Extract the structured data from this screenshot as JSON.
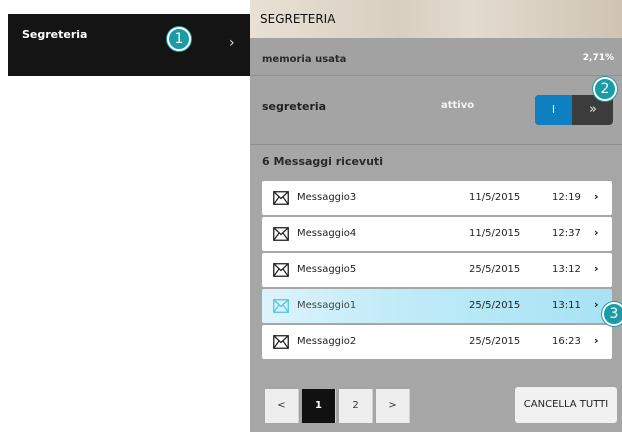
{
  "sidebar": {
    "item_label": "Segreteria",
    "item_chevron": "›"
  },
  "callouts": [
    "1",
    "2",
    "3"
  ],
  "panel": {
    "title": "SEGRETERIA",
    "memory": {
      "label": "memoria usata",
      "value": "2,71%"
    },
    "voicemail": {
      "label": "segreteria",
      "status": "attivo",
      "toggle_on_label": "I",
      "toggle_arrow": "»",
      "enabled": true
    },
    "messages_title": "6 Messaggi ricevuti",
    "messages": [
      {
        "name": "Messaggio3",
        "date": "11/5/2015",
        "time": "12:19",
        "selected": false
      },
      {
        "name": "Messaggio4",
        "date": "11/5/2015",
        "time": "12:37",
        "selected": false
      },
      {
        "name": "Messaggio5",
        "date": "25/5/2015",
        "time": "13:12",
        "selected": false
      },
      {
        "name": "Messaggio1",
        "date": "25/5/2015",
        "time": "13:11",
        "selected": true
      },
      {
        "name": "Messaggio2",
        "date": "25/5/2015",
        "time": "16:23",
        "selected": false
      }
    ],
    "pagination": {
      "prev": "<",
      "pages": [
        "1",
        "2"
      ],
      "current": "1",
      "next": ">"
    },
    "clear_all_label": "CANCELLA TUTTI"
  },
  "colors": {
    "accent": "#1a9ba6",
    "toggle_on": "#0e7fc0",
    "panel_bg": "#a6a6a6",
    "sidebar_bg": "#141414",
    "selected_row": "#c0ebf8"
  }
}
